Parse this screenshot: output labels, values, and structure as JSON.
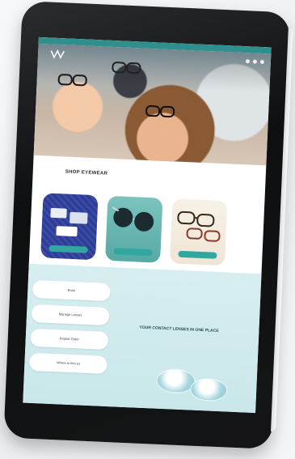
{
  "top_bar_text": "",
  "brand": {
    "logo_text": ""
  },
  "section": {
    "title": "SHOP EYEWEAR",
    "description": ""
  },
  "cards": [
    {
      "button_label": ""
    },
    {
      "button_label": ""
    },
    {
      "button_label": ""
    }
  ],
  "side_menu": [
    {
      "label": "Book"
    },
    {
      "label": "Manage Lenses"
    },
    {
      "label": "Repeat Order"
    },
    {
      "label": "Where to find us"
    }
  ],
  "promo": {
    "title": "YOUR CONTACT LENSES IN ONE PLACE",
    "text": ""
  },
  "colors": {
    "accent": "#31a7a0",
    "top_bar": "#2f8f8d",
    "lower_bg": "#d7eef0",
    "bezel": "#141516"
  },
  "icons": [
    "logo-icon",
    "menu-icon",
    "search-icon",
    "cart-icon",
    "contact-lens-icon"
  ]
}
